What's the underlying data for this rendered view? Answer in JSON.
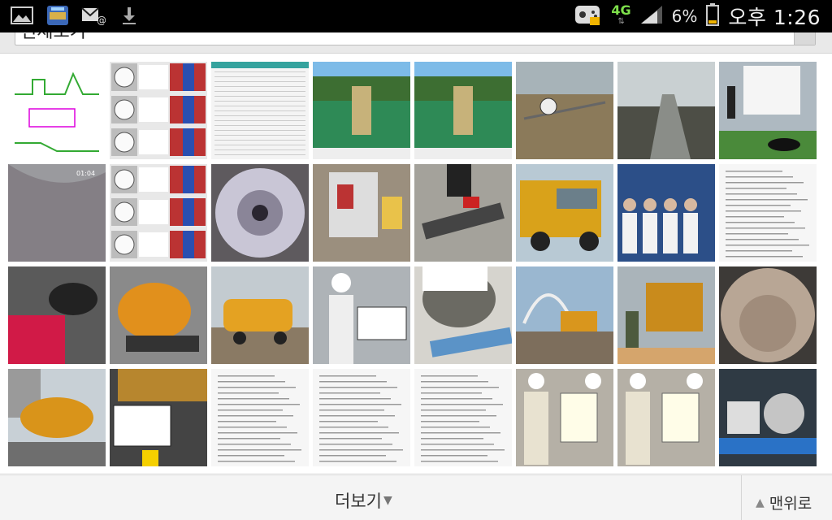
{
  "status_bar": {
    "left_icons": [
      "gallery-icon",
      "image-app-icon",
      "mail-icon",
      "download-icon"
    ],
    "network": "4G",
    "battery": "6%",
    "time": "오후 1:26",
    "accent": "#7ee04b"
  },
  "top_select": {
    "value": "전체보기"
  },
  "gallery": {
    "thumbnails": [
      {
        "name": "diagram-thumbnail",
        "kind": "diagram",
        "bg": "#ffffff"
      },
      {
        "name": "gauge-collage-thumbnail",
        "kind": "collage",
        "bg": "#e8e8e8"
      },
      {
        "name": "data-table-thumbnail",
        "kind": "table",
        "bg": "#f4f4f4"
      },
      {
        "name": "tank-valve-photo-thumbnail",
        "kind": "tank",
        "bg": "#6b9a5a"
      },
      {
        "name": "tank-valve-photo-thumbnail-2",
        "kind": "tank",
        "bg": "#6b9a5a"
      },
      {
        "name": "pressure-gauge-field-thumbnail",
        "kind": "field",
        "bg": "#8b7a5a"
      },
      {
        "name": "shoreline-site-thumbnail",
        "kind": "shore",
        "bg": "#9aa3a6"
      },
      {
        "name": "truck-manhole-thumbnail",
        "kind": "van",
        "bg": "#cfd8df"
      },
      {
        "name": "pipe-interior-thumbnail",
        "kind": "pipe",
        "bg": "#9a9a9e"
      },
      {
        "name": "gauge-collage-thumbnail-2",
        "kind": "collage",
        "bg": "#e8e8e8"
      },
      {
        "name": "pipe-camera-thumbnail",
        "kind": "pipecam",
        "bg": "#5e5a5e"
      },
      {
        "name": "control-panel-thumbnail",
        "kind": "panel",
        "bg": "#9b8f7e"
      },
      {
        "name": "pipe-cutting-thumbnail",
        "kind": "cutting",
        "bg": "#a4a29b"
      },
      {
        "name": "yellow-truck-thumbnail",
        "kind": "truck",
        "bg": "#8fa2ad"
      },
      {
        "name": "exhibition-group-thumbnail",
        "kind": "people",
        "bg": "#2c4f88"
      },
      {
        "name": "document-page-thumbnail",
        "kind": "doc",
        "bg": "#f6f6f6"
      },
      {
        "name": "red-equipment-thumbnail",
        "kind": "redgear",
        "bg": "#5a5a5a"
      },
      {
        "name": "orange-vacuum-truck-thumbnail",
        "kind": "orangetruck",
        "bg": "#c06e1f"
      },
      {
        "name": "yellow-tanker-thumbnail",
        "kind": "tanker",
        "bg": "#98a0a4"
      },
      {
        "name": "pressure-test-worker-thumbnail",
        "kind": "worker",
        "bg": "#aeb3b7"
      },
      {
        "name": "hose-pipe-thumbnail",
        "kind": "hose",
        "bg": "#d6d4ce"
      },
      {
        "name": "bridge-truck-thumbnail",
        "kind": "bridge",
        "bg": "#9ab7d0"
      },
      {
        "name": "site-truck-worker-thumbnail",
        "kind": "siteworker",
        "bg": "#8f9a9f"
      },
      {
        "name": "pipe-soil-thumbnail",
        "kind": "soil",
        "bg": "#8e8175"
      },
      {
        "name": "street-truck-thumbnail",
        "kind": "street",
        "bg": "#8f9aa3"
      },
      {
        "name": "label-sign-thumbnail",
        "kind": "sign",
        "bg": "#b7862e"
      },
      {
        "name": "document-page-thumbnail-2",
        "kind": "doc",
        "bg": "#f6f6f6"
      },
      {
        "name": "document-page-thumbnail-3",
        "kind": "doc",
        "bg": "#f6f6f6"
      },
      {
        "name": "document-page-thumbnail-4",
        "kind": "doc",
        "bg": "#f6f6f6"
      },
      {
        "name": "lab-test-thumbnail",
        "kind": "lab",
        "bg": "#b5b0a6"
      },
      {
        "name": "lab-test-thumbnail-2",
        "kind": "lab",
        "bg": "#b5b0a6"
      },
      {
        "name": "pump-motor-thumbnail",
        "kind": "pump",
        "bg": "#2f3a44"
      }
    ]
  },
  "bottom_bar": {
    "more_label": "더보기",
    "to_top_label": "맨위로"
  }
}
